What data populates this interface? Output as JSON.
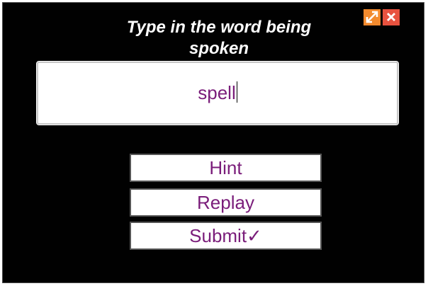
{
  "prompt": {
    "line1": "Type in the word being",
    "line2": "spoken"
  },
  "answer": {
    "value": "spell"
  },
  "buttons": {
    "hint": "Hint",
    "replay": "Replay",
    "submit": "Submit✓"
  },
  "window_controls": {
    "expand_icon": "expand-arrows-icon",
    "close_icon": "close-x-icon",
    "expand_color": "#f28a2e",
    "close_color": "#e8523f"
  },
  "colors": {
    "background": "#010101",
    "text_accent": "#7a1d7a",
    "title_text": "#ffffff"
  }
}
